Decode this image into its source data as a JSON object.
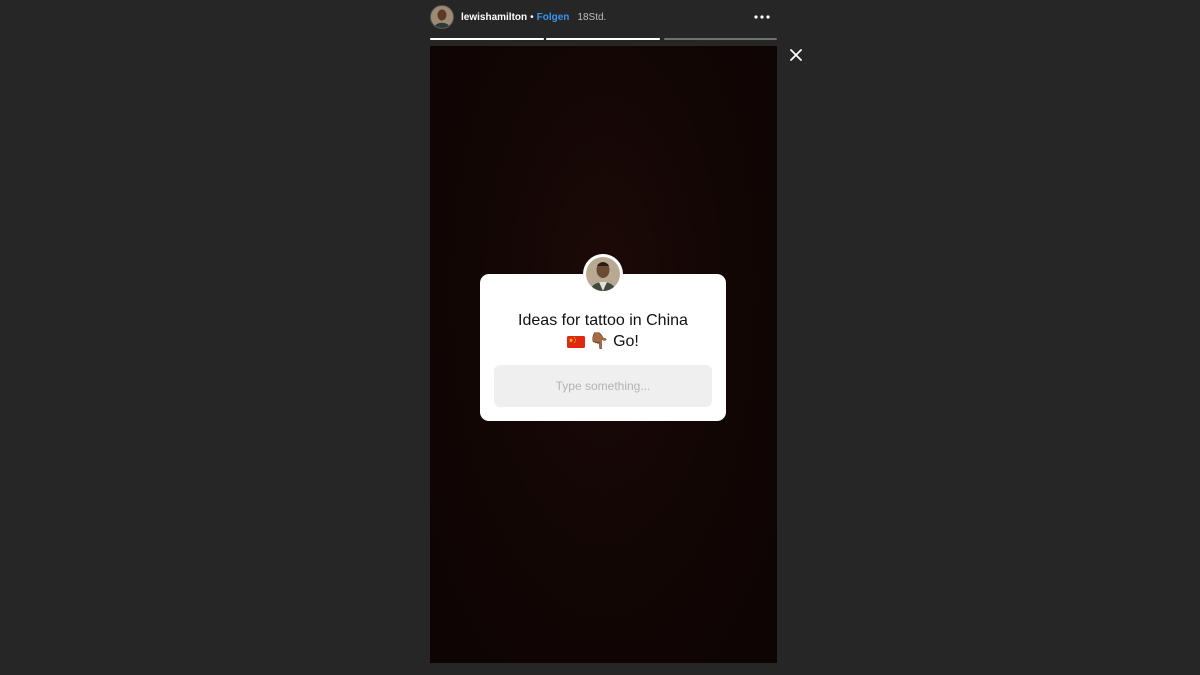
{
  "header": {
    "username": "lewishamilton",
    "separator": "•",
    "follow_label": "Folgen",
    "time": "18Std.",
    "avatar_icon": "profile-photo",
    "more_icon": "more-horizontal-icon"
  },
  "progress": {
    "segments": [
      {
        "fill": 1.0
      },
      {
        "fill": 1.0
      },
      {
        "fill": 0.0
      },
      {
        "fill": 0.0
      }
    ]
  },
  "close": {
    "icon": "close-icon"
  },
  "question_sticker": {
    "title_line1": "Ideas for tattoo in China",
    "title_line2_emoji": "👇🏾",
    "title_line2_text": "Go!",
    "flag_icon": "china-flag-icon",
    "input_placeholder": "Type something..."
  },
  "colors": {
    "background": "#262626",
    "follow_accent": "#3897f0",
    "story_background": "#130605",
    "card": "#ffffff",
    "input_bg": "#efefef"
  }
}
